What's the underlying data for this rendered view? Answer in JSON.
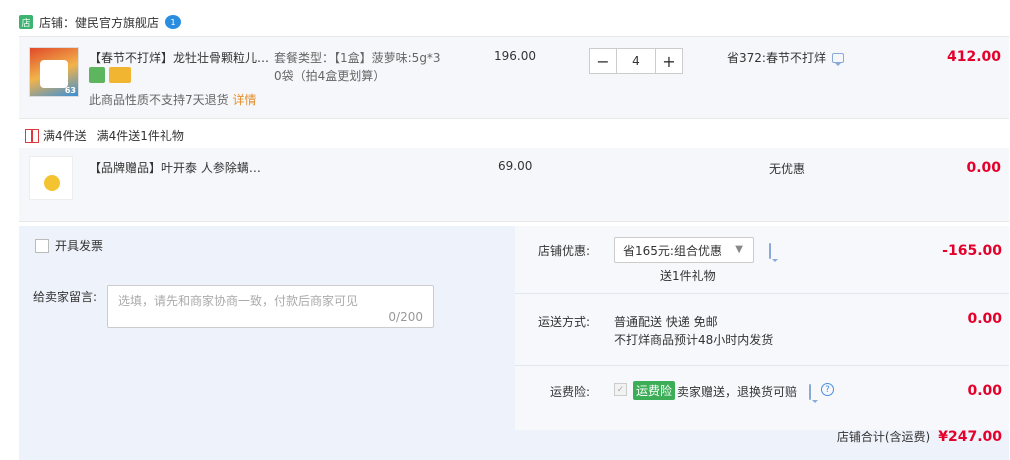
{
  "shop": {
    "label": "店铺：健民官方旗舰店",
    "chat_badge": "1"
  },
  "item1": {
    "title": "【春节不打烊】龙牡壮骨颗粒儿…",
    "spec": "套餐类型：【1盒】菠萝味:5g*30袋（拍4盒更划算）",
    "spec_line1": "套餐类型：【1盒】菠萝味:5g*3",
    "spec_line2": "0袋（拍4盒更划算）",
    "price": "196.00",
    "qty_minus": "−",
    "qty": "4",
    "qty_plus": "+",
    "discount": "省372:春节不打烊",
    "subtotal": "412.00",
    "notice": "此商品性质不支持7天退货",
    "notice_link": "详情",
    "thumb_badge": "63"
  },
  "gift": {
    "tag1": "满4件送",
    "tag2": "满4件送1件礼物",
    "title": "【品牌赠品】叶开泰 人参除螨…",
    "price": "69.00",
    "discount": "无优惠",
    "subtotal": "0.00"
  },
  "invoice": {
    "label": "开具发票"
  },
  "remark": {
    "label": "给卖家留言:",
    "placeholder": "选填，请先和商家协商一致，付款后商家可见",
    "count": "0/200"
  },
  "store_discount": {
    "label": "店铺优惠:",
    "selected": "省165元:组合优惠",
    "sub": "送1件礼物",
    "amount": "-165.00"
  },
  "shipping": {
    "label": "运送方式:",
    "method": "普通配送 快递 免邮",
    "note": "不打烊商品预计48小时内发货",
    "amount": "0.00"
  },
  "insurance": {
    "label": "运费险:",
    "badge": "运费险",
    "desc": "卖家赠送，退换货可赔",
    "help": "?",
    "amount": "0.00"
  },
  "total": {
    "label": "店铺合计(含运费)",
    "amount": "¥247.00"
  },
  "colors": {
    "price_red": "#e4002b",
    "panel_bg": "#eef2fa",
    "badge_green": "#3dae58"
  }
}
